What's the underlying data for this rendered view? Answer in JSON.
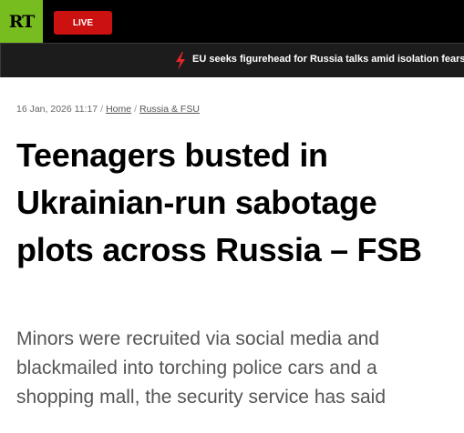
{
  "header": {
    "logo_text": "RT",
    "live_label": "LIVE",
    "brand_color": "#77bd1f",
    "live_color": "#cc1111"
  },
  "ticker": {
    "icon": "lightning-icon",
    "headline": "EU seeks figurehead for Russia talks amid isolation fears"
  },
  "article": {
    "date": "16 Jan, 2026 11:17",
    "breadcrumbs": [
      "Home",
      "Russia & FSU"
    ],
    "title": "Teenagers busted in Ukrainian-run sabotage plots across Russia – FSB",
    "summary": "Minors were recruited via social media and blackmailed into torching police cars and a shopping mall, the security service has said"
  }
}
